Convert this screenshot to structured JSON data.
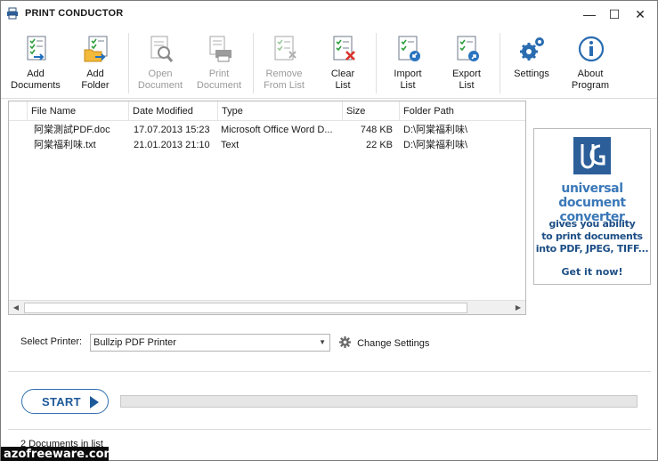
{
  "window": {
    "title": "PRINT CONDUCTOR",
    "controls": {
      "minimize": "—",
      "maximize": "☐",
      "close": "✕"
    }
  },
  "toolbar": {
    "add_documents": "Add\nDocuments",
    "add_folder": "Add\nFolder",
    "open_document": "Open\nDocument",
    "print_document": "Print\nDocument",
    "remove_from_list": "Remove\nFrom List",
    "clear_list": "Clear\nList",
    "import_list": "Import\nList",
    "export_list": "Export\nList",
    "settings": "Settings",
    "about_program": "About\nProgram"
  },
  "file_list": {
    "columns": [
      "File Name",
      "Date Modified",
      "Type",
      "Size",
      "Folder Path"
    ],
    "rows": [
      {
        "name": "阿棠測試PDF.doc",
        "date": "17.07.2013 15:23",
        "type": "Microsoft Office Word D...",
        "size": "748 KB",
        "path": "D:\\阿棠福利味\\"
      },
      {
        "name": "阿棠福利味.txt",
        "date": "21.01.2013 21:10",
        "type": "Text",
        "size": "22 KB",
        "path": "D:\\阿棠福利味\\"
      }
    ]
  },
  "ad": {
    "headline": "universal document converter",
    "body": "gives you ability\nto print documents\ninto PDF, JPEG, TIFF...",
    "cta": "Get it now!"
  },
  "printer": {
    "label": "Select Printer:",
    "selected": "Bullzip PDF Printer",
    "change_settings": "Change Settings"
  },
  "start": {
    "label": "START"
  },
  "progress": {
    "value": 0
  },
  "status": {
    "text": "2 Documents in list"
  },
  "watermark": {
    "text": "azofreeware.com"
  },
  "colors": {
    "accent": "#1e5a99",
    "brand_blue": "#3a78b8",
    "icon_green": "#2e9e3e",
    "icon_red": "#d9312b"
  }
}
